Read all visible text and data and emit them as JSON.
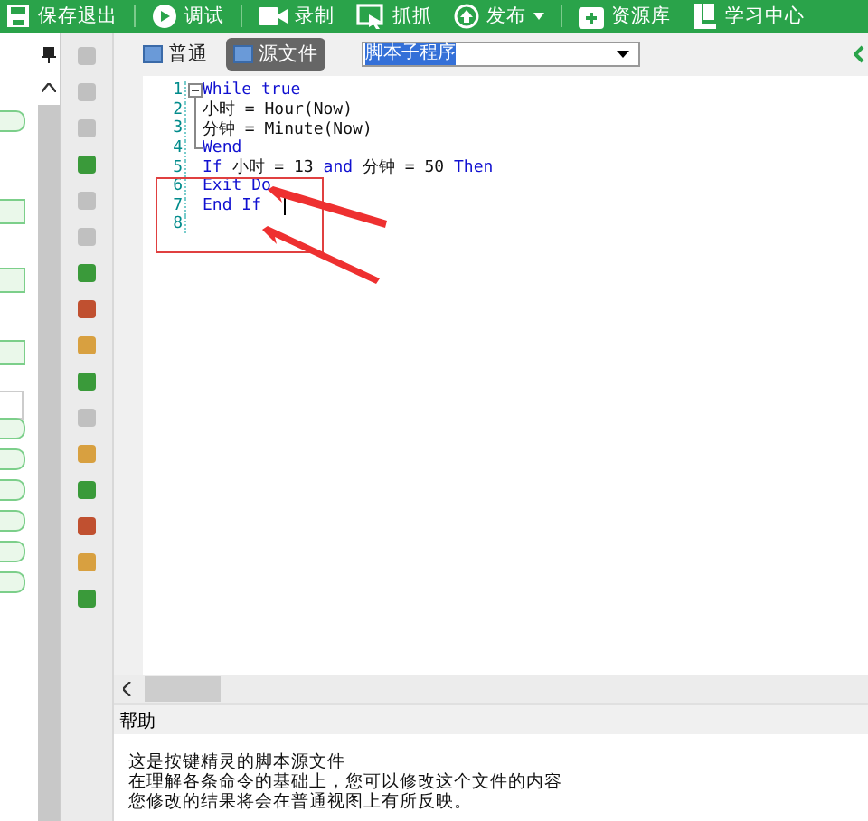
{
  "toolbar": [
    {
      "label": "保存退出",
      "dropdown": false
    },
    {
      "label": "调试",
      "dropdown": false
    },
    {
      "label": "录制",
      "dropdown": false
    },
    {
      "label": "抓抓",
      "dropdown": false
    },
    {
      "label": "发布",
      "dropdown": true
    },
    {
      "label": "资源库",
      "dropdown": false
    },
    {
      "label": "学习中心",
      "dropdown": false
    }
  ],
  "view_tabs": [
    {
      "label": "普通",
      "selected": false
    },
    {
      "label": "源文件",
      "selected": true
    }
  ],
  "subroutine_select": {
    "value": "脚本子程序"
  },
  "code_lines": [
    {
      "number": "1",
      "kind": "fold-start",
      "tokens": [
        {
          "kind": "keyword",
          "text": "While true"
        }
      ]
    },
    {
      "number": "2",
      "kind": "fold-inside",
      "tokens": [
        {
          "kind": "plain",
          "text": "小时 = Hour(Now)"
        }
      ]
    },
    {
      "number": "3",
      "kind": "fold-inside",
      "tokens": [
        {
          "kind": "plain",
          "text": "分钟 = Minute(Now)"
        }
      ]
    },
    {
      "number": "4",
      "kind": "fold-end",
      "tokens": [
        {
          "kind": "keyword",
          "text": "Wend"
        }
      ]
    },
    {
      "number": "5",
      "kind": "plain",
      "tokens": [
        {
          "kind": "keyword",
          "text": "If"
        },
        {
          "kind": "plain",
          "text": " 小时 = 13 "
        },
        {
          "kind": "keyword",
          "text": "and"
        },
        {
          "kind": "plain",
          "text": " 分钟 = 50 "
        },
        {
          "kind": "keyword",
          "text": "Then"
        }
      ]
    },
    {
      "number": "6",
      "kind": "plain",
      "tokens": [
        {
          "kind": "keyword",
          "text": "Exit Do"
        }
      ]
    },
    {
      "number": "7",
      "kind": "plain",
      "caret": true,
      "tokens": [
        {
          "kind": "keyword",
          "text": "End If"
        }
      ]
    },
    {
      "number": "8",
      "kind": "plain"
    }
  ],
  "help": {
    "title": "帮助",
    "lines": [
      "这是按键精灵的脚本源文件",
      "在理解各条命令的基础上，您可以修改这个文件的内容",
      "您修改的结果将会在普通视图上有所反映。"
    ]
  }
}
